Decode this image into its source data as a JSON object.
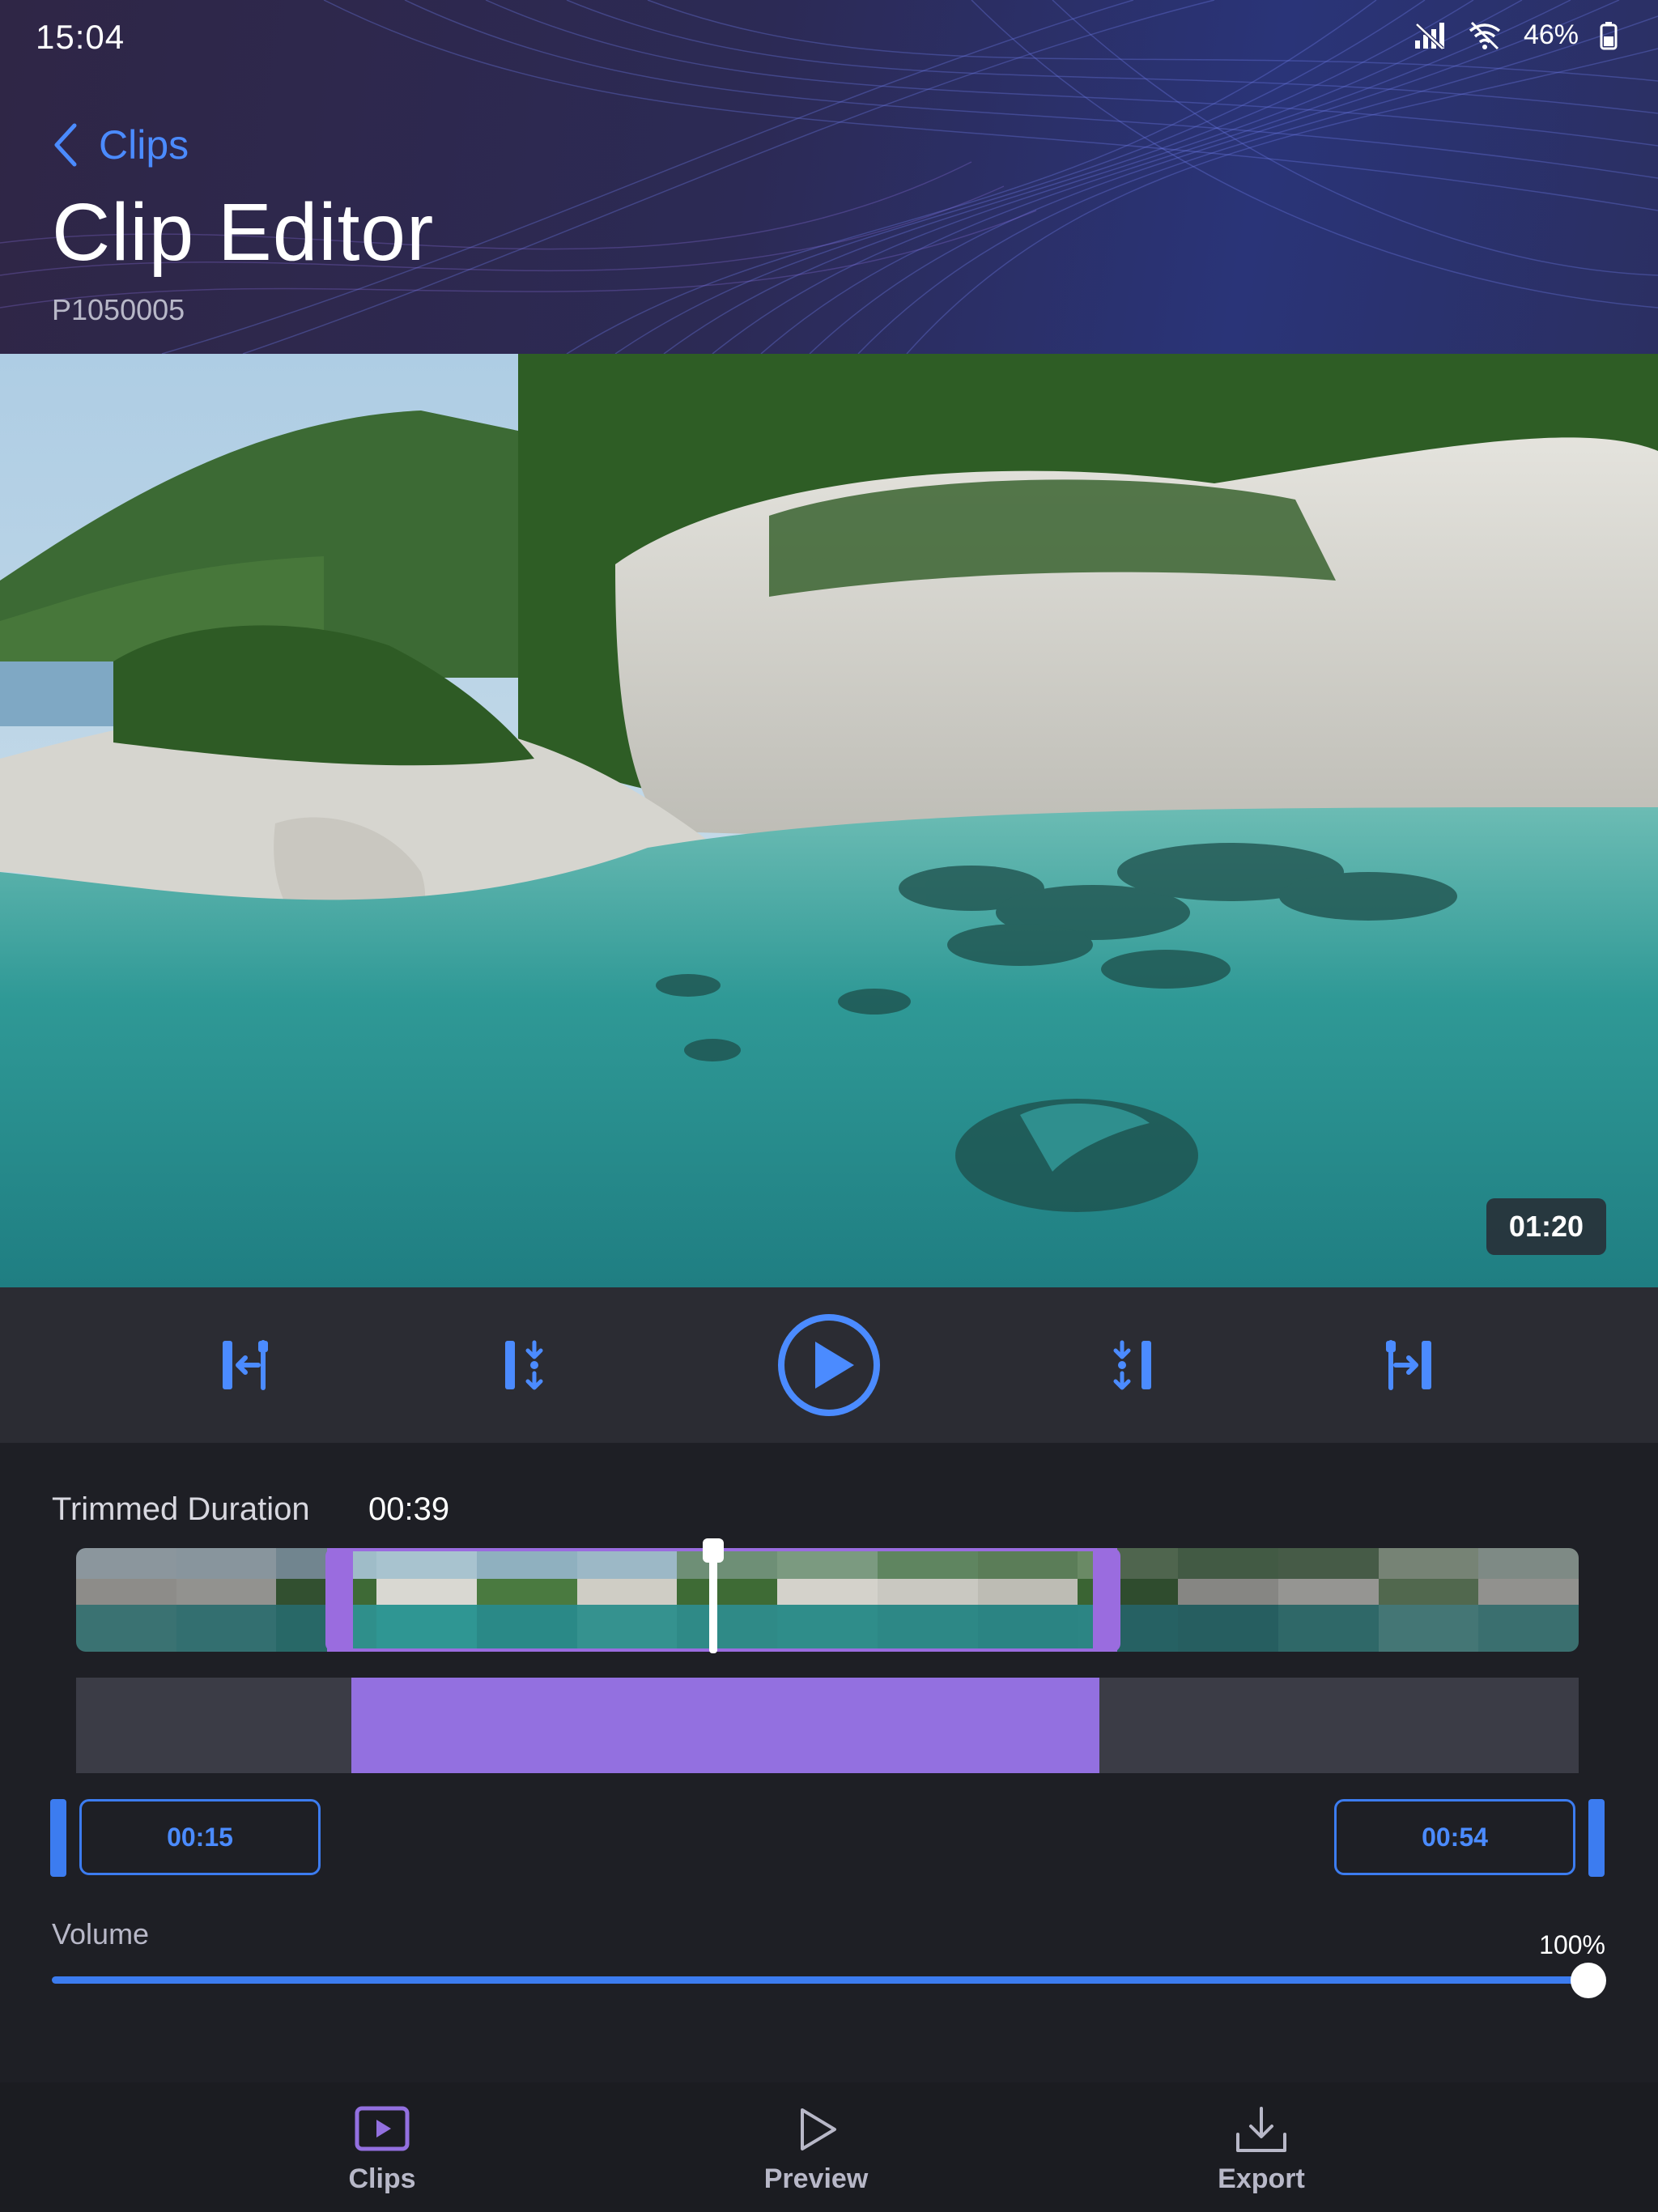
{
  "status_bar": {
    "time": "15:04",
    "battery": "46%",
    "icons": [
      "no-signal-icon",
      "wifi-off-icon",
      "battery-icon"
    ]
  },
  "header": {
    "back_label": "Clips",
    "title": "Clip Editor",
    "subtitle": "P1050005"
  },
  "video": {
    "duration": "01:20"
  },
  "controls": {
    "buttons": [
      "jump-to-start-icon",
      "set-in-point-icon",
      "play-icon",
      "set-out-point-icon",
      "jump-to-end-icon"
    ]
  },
  "trim": {
    "label": "Trimmed Duration",
    "value": "00:39",
    "start": "00:15",
    "end": "00:54",
    "range_start_fraction": 0.183,
    "range_end_fraction": 0.68,
    "playhead_fraction": 0.423
  },
  "volume": {
    "label": "Volume",
    "value": "100%",
    "level": 1.0
  },
  "tabs": [
    {
      "label": "Clips",
      "icon": "clips-icon",
      "active": true
    },
    {
      "label": "Preview",
      "icon": "play-outline-icon",
      "active": false
    },
    {
      "label": "Export",
      "icon": "download-icon",
      "active": false
    }
  ],
  "colors": {
    "accent_blue": "#3c7cf0",
    "accent_purple": "#9370e0",
    "background": "#1e1f25"
  }
}
